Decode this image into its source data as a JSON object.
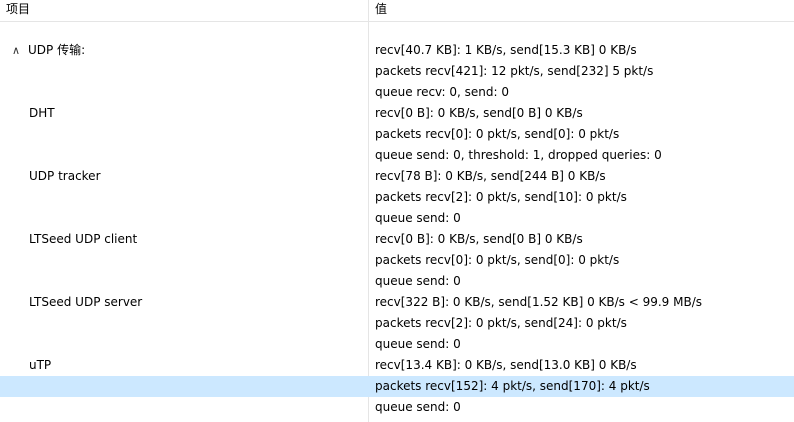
{
  "header": {
    "col_name": "项目",
    "col_value": "值"
  },
  "tree": {
    "root": {
      "label": "UDP 传输:",
      "expanded": true,
      "icon": "chevron-up-icon",
      "values": [
        "recv[40.7 KB]: 1 KB/s, send[15.3 KB] 0 KB/s",
        "packets recv[421]: 12 pkt/s, send[232] 5 pkt/s",
        "queue recv: 0, send: 0"
      ]
    },
    "children": [
      {
        "label": "DHT",
        "values": [
          "recv[0 B]: 0 KB/s, send[0 B] 0 KB/s",
          "packets recv[0]: 0 pkt/s, send[0]: 0 pkt/s",
          "queue send: 0, threshold: 1, dropped queries: 0"
        ]
      },
      {
        "label": "UDP tracker",
        "values": [
          "recv[78 B]: 0 KB/s, send[244 B] 0 KB/s",
          "packets recv[2]: 0 pkt/s, send[10]: 0 pkt/s",
          "queue send: 0"
        ]
      },
      {
        "label": "LTSeed UDP client",
        "values": [
          "recv[0 B]: 0 KB/s, send[0 B] 0 KB/s",
          "packets recv[0]: 0 pkt/s, send[0]: 0 pkt/s",
          "queue send: 0"
        ]
      },
      {
        "label": "LTSeed UDP server",
        "values": [
          "recv[322 B]: 0 KB/s, send[1.52 KB] 0 KB/s < 99.9 MB/s",
          "packets recv[2]: 0 pkt/s, send[24]: 0 pkt/s",
          "queue send: 0"
        ]
      },
      {
        "label": "uTP",
        "values": [
          "recv[13.4 KB]: 0 KB/s, send[13.0 KB] 0 KB/s",
          "packets recv[152]: 4 pkt/s, send[170]: 4 pkt/s",
          "queue send: 0"
        ],
        "selected_line": 1
      }
    ]
  },
  "colors": {
    "selection": "#cce8ff",
    "grid": "#e5e5e5",
    "text": "#000000"
  }
}
